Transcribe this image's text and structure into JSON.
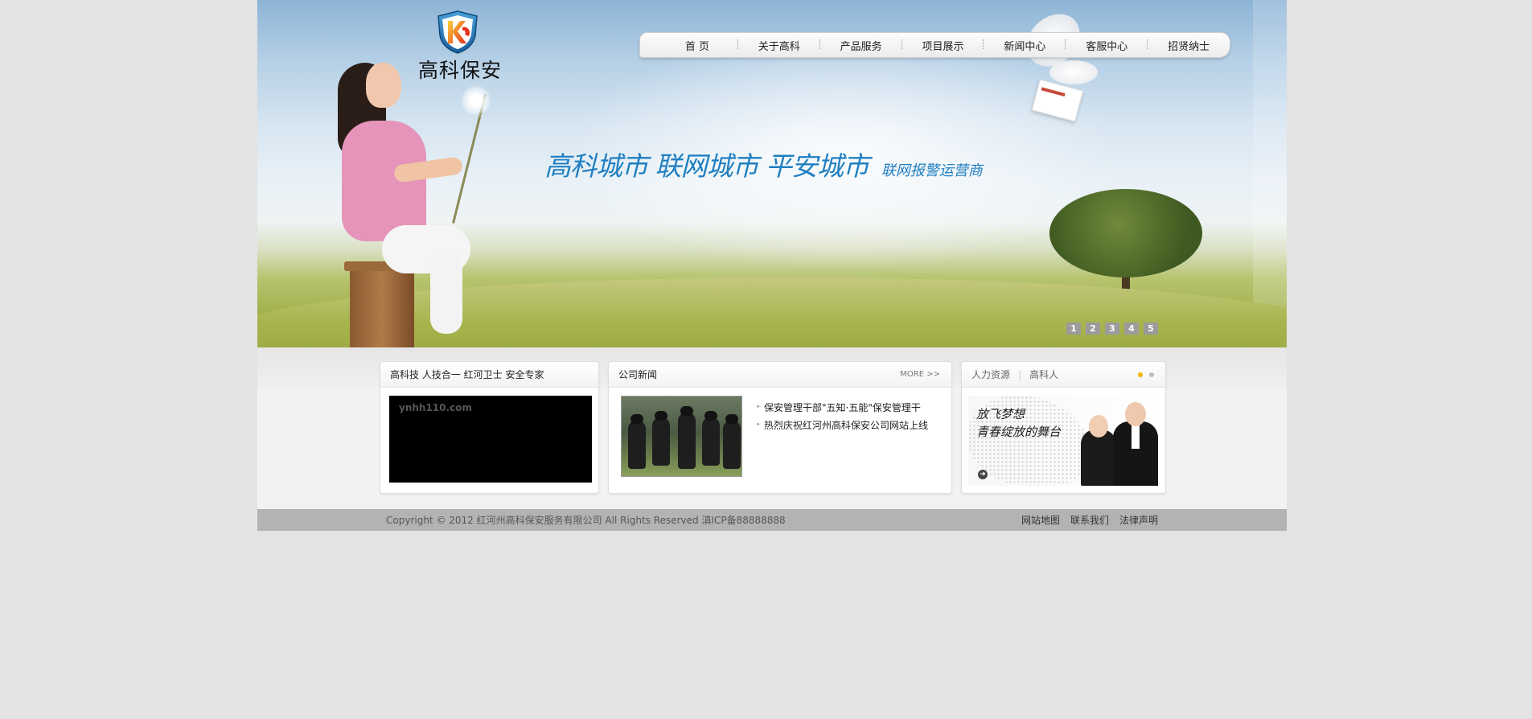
{
  "brand": {
    "name": "高科保安",
    "accent": "#1f7fc1"
  },
  "nav": {
    "items": [
      "首 页",
      "关于高科",
      "产品服务",
      "项目展示",
      "新闻中心",
      "客服中心",
      "招贤纳士"
    ]
  },
  "banner": {
    "slogan": "高科城市 联网城市 平安城市",
    "subslogan": "联网报警运营商",
    "pages": [
      "1",
      "2",
      "3",
      "4",
      "5"
    ]
  },
  "panel_video": {
    "title": "高科技 人技合一 红河卫士 安全专家",
    "watermark": "ynhh110.com"
  },
  "panel_news": {
    "title": "公司新闻",
    "more": "MORE >>",
    "items": [
      "保安管理干部\"五知·五能\"保安管理干",
      "热烈庆祝红河州高科保安公司网站上线"
    ]
  },
  "panel_hr": {
    "tabs": [
      "人力资源",
      "高科人"
    ],
    "line1": "放飞梦想",
    "line2": "青春绽放的舞台",
    "arrow_icon": "arrow-right-icon"
  },
  "footer": {
    "copyright": "Copyright © 2012 红河州高科保安服务有限公司 All Rights Reserved 滇ICP备88888888",
    "links": [
      "网站地图",
      "联系我们",
      "法律声明"
    ]
  }
}
